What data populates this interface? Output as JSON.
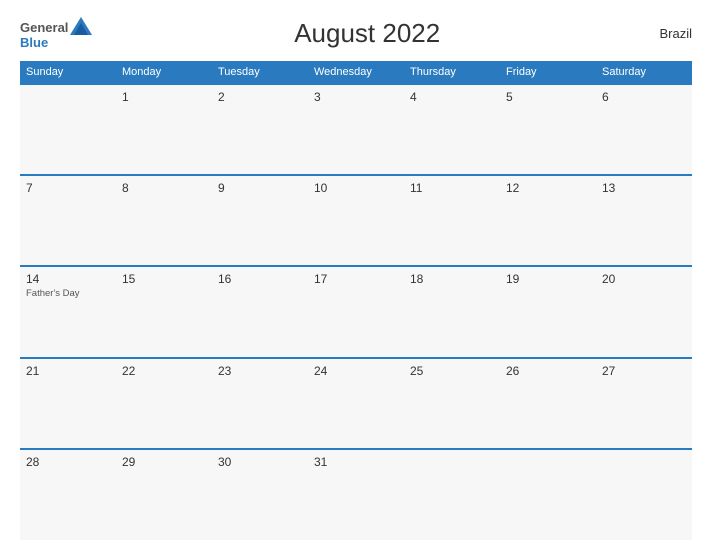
{
  "header": {
    "logo_general": "General",
    "logo_blue": "Blue",
    "title": "August 2022",
    "country": "Brazil"
  },
  "weekdays": [
    "Sunday",
    "Monday",
    "Tuesday",
    "Wednesday",
    "Thursday",
    "Friday",
    "Saturday"
  ],
  "weeks": [
    [
      {
        "day": "",
        "holiday": ""
      },
      {
        "day": "1",
        "holiday": ""
      },
      {
        "day": "2",
        "holiday": ""
      },
      {
        "day": "3",
        "holiday": ""
      },
      {
        "day": "4",
        "holiday": ""
      },
      {
        "day": "5",
        "holiday": ""
      },
      {
        "day": "6",
        "holiday": ""
      }
    ],
    [
      {
        "day": "7",
        "holiday": ""
      },
      {
        "day": "8",
        "holiday": ""
      },
      {
        "day": "9",
        "holiday": ""
      },
      {
        "day": "10",
        "holiday": ""
      },
      {
        "day": "11",
        "holiday": ""
      },
      {
        "day": "12",
        "holiday": ""
      },
      {
        "day": "13",
        "holiday": ""
      }
    ],
    [
      {
        "day": "14",
        "holiday": "Father's Day"
      },
      {
        "day": "15",
        "holiday": ""
      },
      {
        "day": "16",
        "holiday": ""
      },
      {
        "day": "17",
        "holiday": ""
      },
      {
        "day": "18",
        "holiday": ""
      },
      {
        "day": "19",
        "holiday": ""
      },
      {
        "day": "20",
        "holiday": ""
      }
    ],
    [
      {
        "day": "21",
        "holiday": ""
      },
      {
        "day": "22",
        "holiday": ""
      },
      {
        "day": "23",
        "holiday": ""
      },
      {
        "day": "24",
        "holiday": ""
      },
      {
        "day": "25",
        "holiday": ""
      },
      {
        "day": "26",
        "holiday": ""
      },
      {
        "day": "27",
        "holiday": ""
      }
    ],
    [
      {
        "day": "28",
        "holiday": ""
      },
      {
        "day": "29",
        "holiday": ""
      },
      {
        "day": "30",
        "holiday": ""
      },
      {
        "day": "31",
        "holiday": ""
      },
      {
        "day": "",
        "holiday": ""
      },
      {
        "day": "",
        "holiday": ""
      },
      {
        "day": "",
        "holiday": ""
      }
    ]
  ]
}
